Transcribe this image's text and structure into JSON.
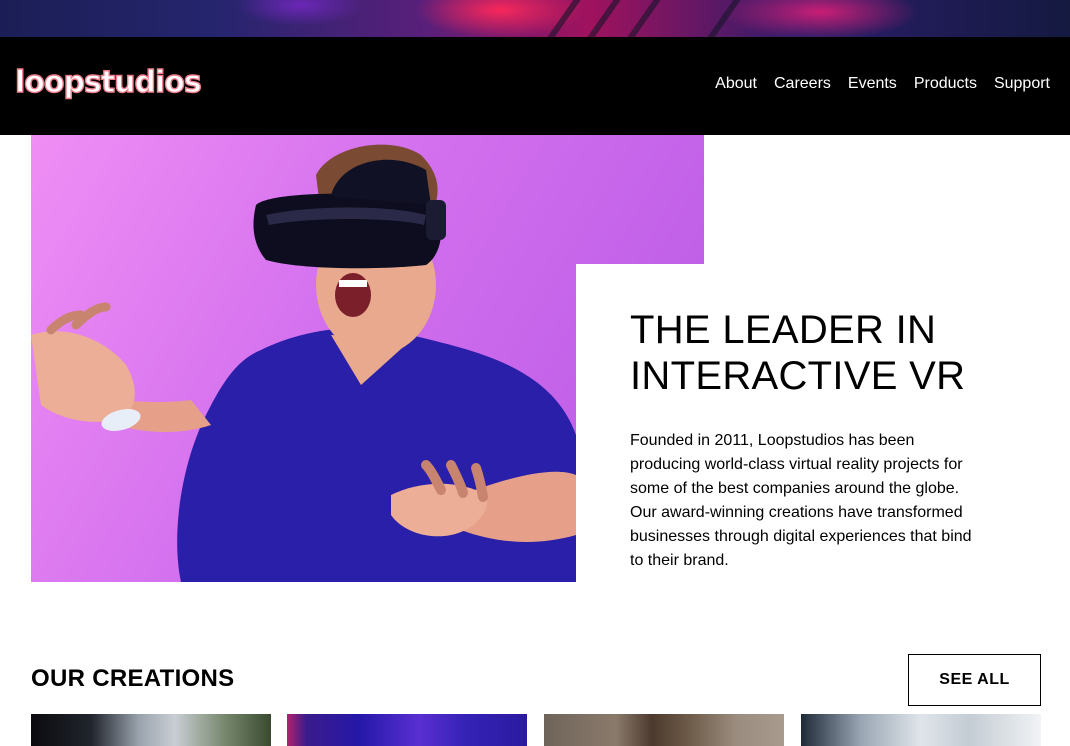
{
  "brand": {
    "logo_text": "loopstudios",
    "accent": "#ef7c8a"
  },
  "nav": {
    "items": [
      {
        "label": "About"
      },
      {
        "label": "Careers"
      },
      {
        "label": "Events"
      },
      {
        "label": "Products"
      },
      {
        "label": "Support"
      }
    ]
  },
  "hero": {
    "image_icon": "vr-headset-person-photo"
  },
  "intro": {
    "headline": "THE LEADER IN INTERACTIVE VR",
    "body": "Founded in 2011, Loopstudios has been producing world-class virtual reality projects for some of the best companies around the globe. Our award-winning creations have transformed businesses through digital experiences that bind to their brand."
  },
  "creations": {
    "title": "OUR CREATIONS",
    "see_all_label": "SEE ALL"
  }
}
